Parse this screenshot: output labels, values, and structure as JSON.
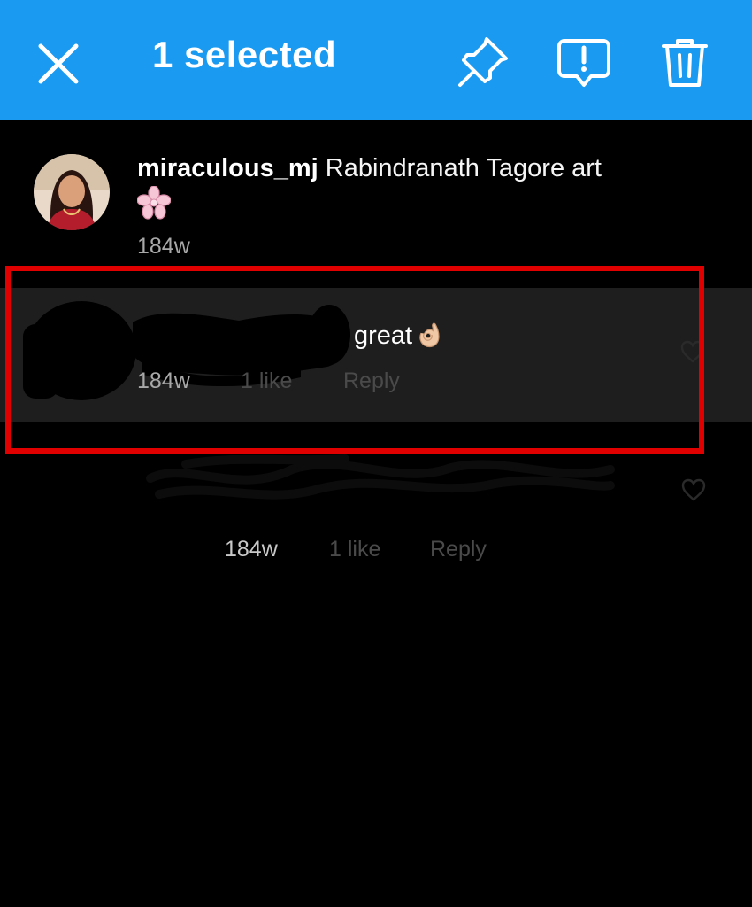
{
  "colors": {
    "header_bg": "#1a9af0",
    "highlight": "#e00000",
    "selected_bg": "#1e1e1e"
  },
  "header": {
    "close_icon": "close-icon",
    "title": "1 selected",
    "actions": [
      {
        "icon": "pin-icon"
      },
      {
        "icon": "report-icon"
      },
      {
        "icon": "trash-icon"
      }
    ]
  },
  "caption": {
    "username": "miraculous_mj",
    "text": "Rabindranath Tagore art",
    "emoji": "flower-emoji",
    "time": "184w"
  },
  "comments": [
    {
      "username": "",
      "text": "great",
      "emoji": "ok-hand-emoji",
      "time": "184w",
      "likes": "1 like",
      "reply": "Reply",
      "selected": true
    },
    {
      "username": "",
      "text": "",
      "time": "184w",
      "likes": "1 like",
      "reply": "Reply",
      "selected": false
    }
  ]
}
